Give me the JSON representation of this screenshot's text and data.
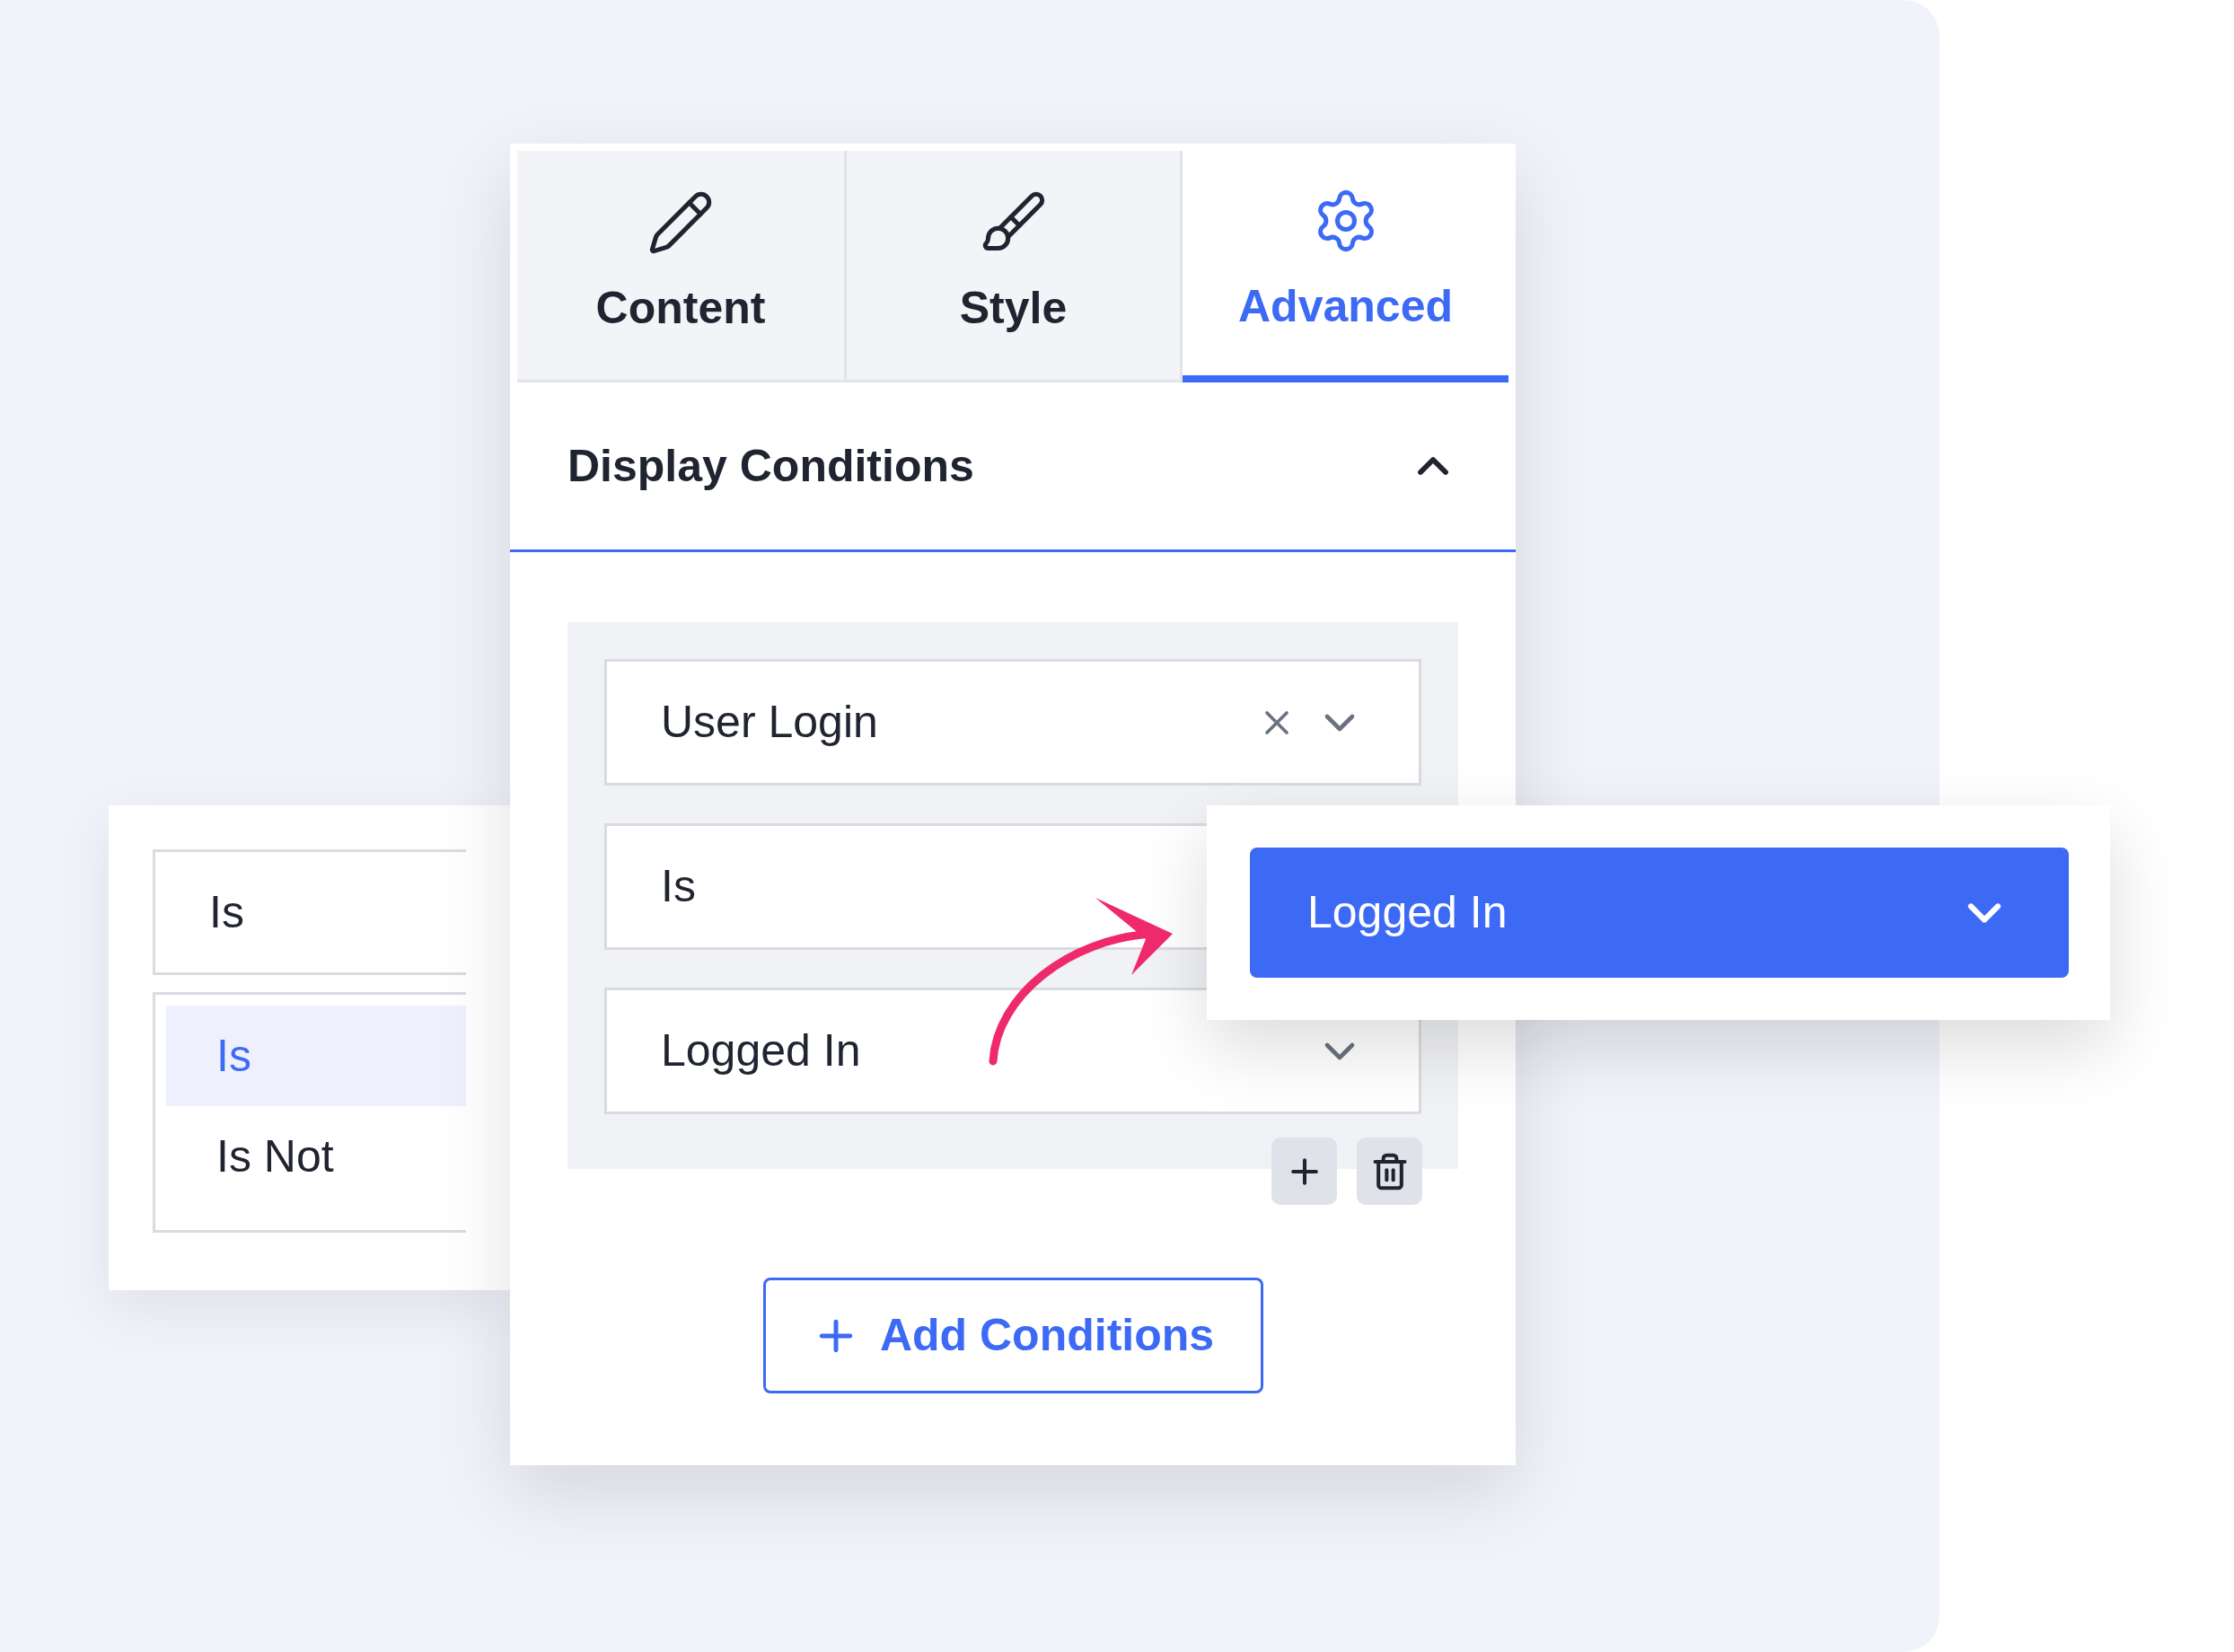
{
  "tabs": [
    {
      "label": "Content",
      "selected": false
    },
    {
      "label": "Style",
      "selected": false
    },
    {
      "label": "Advanced",
      "selected": true
    }
  ],
  "section": {
    "title": "Display Conditions",
    "expanded": true
  },
  "condition": {
    "type_field": {
      "value": "User Login"
    },
    "operator_field": {
      "value": "Is"
    },
    "value_field": {
      "value": "Logged In"
    }
  },
  "add_button": {
    "label": "Add Conditions"
  },
  "operator_dropdown": {
    "value": "Is",
    "options": [
      {
        "label": "Is",
        "selected": true
      },
      {
        "label": "Is Not",
        "selected": false
      }
    ]
  },
  "value_popup": {
    "value": "Logged In"
  }
}
